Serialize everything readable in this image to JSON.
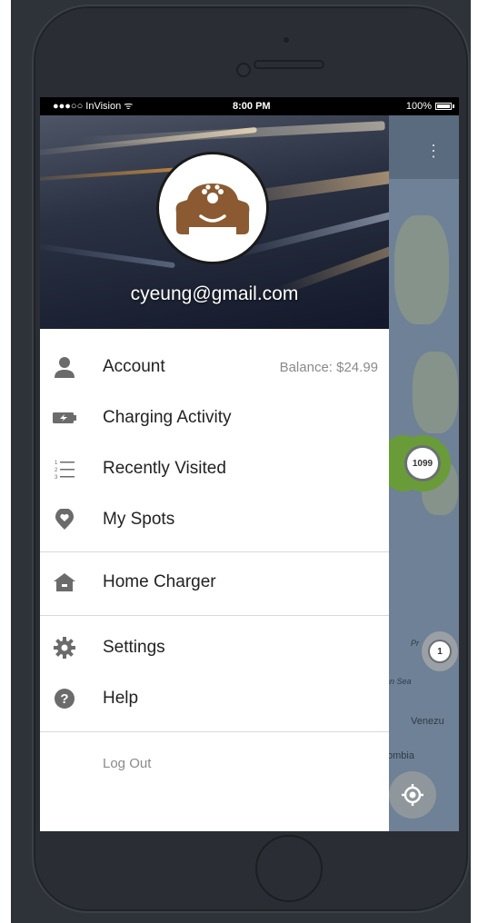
{
  "status_bar": {
    "carrier": "●●●○○ InVision ᯤ",
    "time": "8:00 PM",
    "battery": "100%"
  },
  "drawer": {
    "email": "cyeung@gmail.com",
    "menu_items": [
      {
        "label": "Account",
        "icon": "person-icon",
        "aside": "Balance: $24.99"
      },
      {
        "label": "Charging Activity",
        "icon": "battery-charging-icon"
      },
      {
        "label": "Recently Visited",
        "icon": "numbered-list-icon"
      },
      {
        "label": "My Spots",
        "icon": "heart-pin-icon"
      },
      {
        "label": "Home Charger",
        "icon": "home-icon"
      },
      {
        "label": "Settings",
        "icon": "gear-icon"
      },
      {
        "label": "Help",
        "icon": "help-icon"
      }
    ],
    "logout": "Log Out"
  },
  "map": {
    "cluster_large": "1099",
    "cluster_small": "1",
    "label_sea": "an Sea",
    "label_venezuela": "Venezu",
    "label_colombia": "ombia",
    "label_pr": "Pr"
  },
  "colors": {
    "avatar_car": "#8b5a32",
    "cluster_green": "#6a9b39",
    "icon_gray": "#6b6b6b"
  }
}
